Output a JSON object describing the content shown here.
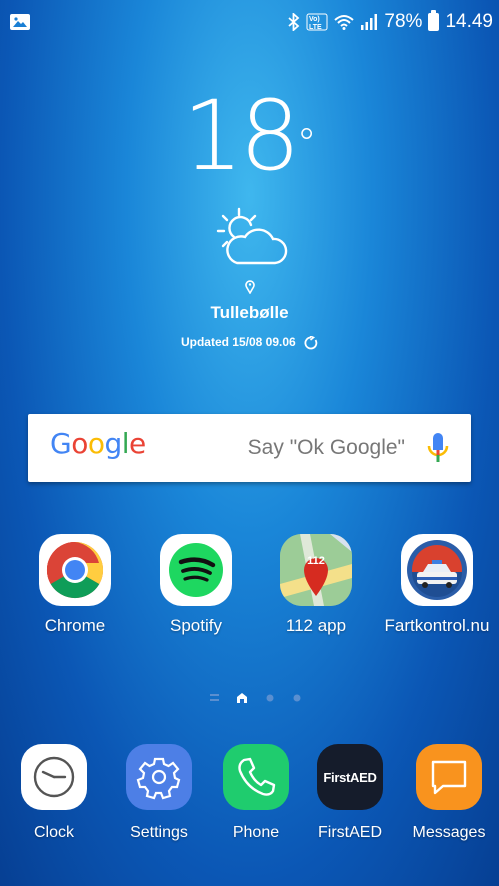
{
  "status_bar": {
    "battery_percent": "78%",
    "time": "14.49",
    "volte_label": "Vo)) LTE"
  },
  "weather": {
    "temperature": "18",
    "degree_symbol": "°",
    "location": "Tullebølle",
    "updated": "Updated 15/08 09.06"
  },
  "search": {
    "logo": [
      "G",
      "o",
      "o",
      "g",
      "l",
      "e"
    ],
    "hint": "Say \"Ok Google\""
  },
  "apps": [
    {
      "label": "Chrome"
    },
    {
      "label": "Spotify"
    },
    {
      "label": "112 app",
      "badge": "112"
    },
    {
      "label": "Fartkontrol.nu"
    }
  ],
  "dock": [
    {
      "label": "Clock"
    },
    {
      "label": "Settings"
    },
    {
      "label": "Phone"
    },
    {
      "label": "FirstAED",
      "icon_text": "FirstAED"
    },
    {
      "label": "Messages"
    }
  ],
  "colors": {
    "google_blue": "#4285F4",
    "google_red": "#EA4335",
    "google_yellow": "#FBBC05",
    "google_green": "#34A853",
    "spotify_green": "#1ED760",
    "phone_green": "#1FCC6E",
    "settings_blue": "#4D7FE6",
    "messages_orange": "#F9931E",
    "firstaed_dark": "#151C2B"
  }
}
